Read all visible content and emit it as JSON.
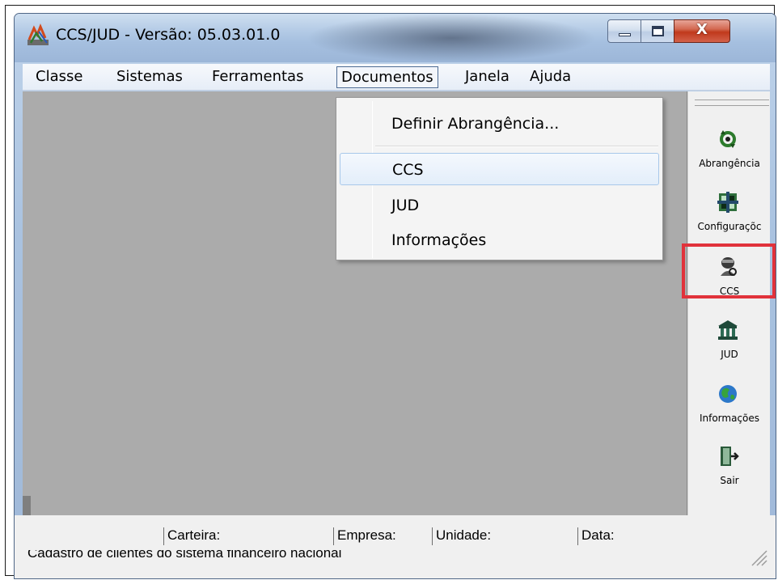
{
  "window": {
    "title": "CCS/JUD - Versão: 05.03.01.0",
    "minimize_label": "",
    "maximize_label": "",
    "close_label": "X"
  },
  "menubar": {
    "items": [
      {
        "label": "Classe"
      },
      {
        "label": "Sistemas"
      },
      {
        "label": "Ferramentas"
      },
      {
        "label": "Documentos",
        "open": true
      },
      {
        "label": "Janela"
      },
      {
        "label": "Ajuda"
      }
    ]
  },
  "dropdown": {
    "items": [
      {
        "label": "Definir Abrangência..."
      },
      {
        "label": "CCS",
        "highlighted": true
      },
      {
        "label": "JUD"
      },
      {
        "label": "Informações"
      }
    ]
  },
  "toolbar": {
    "buttons": [
      {
        "label": "Abrangência",
        "icon": "refresh-arrows-icon"
      },
      {
        "label": "Configuraçõc",
        "icon": "settings-grid-icon"
      },
      {
        "label": "CCS",
        "icon": "person-search-icon",
        "selected": true
      },
      {
        "label": "JUD",
        "icon": "courthouse-icon"
      },
      {
        "label": "Informações",
        "icon": "globe-icon"
      },
      {
        "label": "Sair",
        "icon": "exit-door-icon"
      }
    ]
  },
  "statusbar": {
    "carteira_label": "Carteira:",
    "empresa_label": "Empresa:",
    "unidade_label": "Unidade:",
    "data_label": "Data:",
    "message": "Cadastro de clientes do sistema financeiro nacional"
  },
  "colors": {
    "highlight_border": "#e1323b",
    "client_area": "#ababab",
    "close_button": "#c0391c"
  }
}
